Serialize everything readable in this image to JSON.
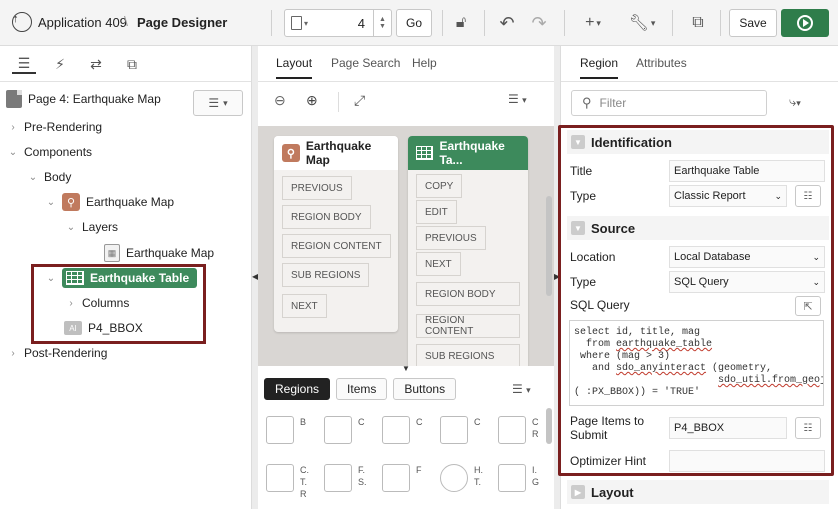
{
  "toolbar": {
    "app_name": "Application 409",
    "page_designer": "Page Designer",
    "page_number": "4",
    "go_label": "Go",
    "save_label": "Save"
  },
  "left_pane": {
    "page_title": "Page 4: Earthquake Map",
    "tree": {
      "pre_rendering": "Pre-Rendering",
      "components": "Components",
      "body": "Body",
      "earthquake_map": "Earthquake Map",
      "layers": "Layers",
      "layer_earthquake_map": "Earthquake Map",
      "earthquake_table": "Earthquake Table",
      "columns": "Columns",
      "item": "P4_BBOX",
      "item_badge": "AI",
      "post_rendering": "Post-Rendering"
    }
  },
  "mid_pane": {
    "tabs": [
      "Layout",
      "Page Search",
      "Help"
    ],
    "map_card": {
      "title": "Earthquake Map",
      "slots": [
        "PREVIOUS",
        "REGION BODY",
        "REGION CONTENT",
        "SUB REGIONS",
        "NEXT"
      ]
    },
    "table_card": {
      "title": "Earthquake Ta...",
      "slots": [
        "COPY",
        "EDIT",
        "PREVIOUS",
        "NEXT",
        "REGION BODY",
        "REGION CONTENT",
        "SUB REGIONS"
      ]
    },
    "gallery_tabs": [
      "Regions",
      "Items",
      "Buttons"
    ],
    "gallery_row1": [
      "B",
      "C",
      "C",
      "C",
      "C\nR"
    ],
    "gallery_row2": [
      "C.\nT.\nR",
      "F.\nS.",
      "F",
      "H.\nT.",
      "I.\nG"
    ]
  },
  "right_pane": {
    "tabs": [
      "Region",
      "Attributes"
    ],
    "filter_placeholder": "Filter",
    "identification": {
      "header": "Identification",
      "title_label": "Title",
      "title_value": "Earthquake Table",
      "type_label": "Type",
      "type_value": "Classic Report"
    },
    "source": {
      "header": "Source",
      "location_label": "Location",
      "location_value": "Local Database",
      "type_label": "Type",
      "type_value": "SQL Query",
      "sql_label": "SQL Query",
      "sql_line1": "select id, title, mag",
      "sql_line2_a": "  from ",
      "sql_line2_b": "earthquake_table",
      "sql_line3": " where (mag > 3)",
      "sql_line4_a": "   and ",
      "sql_line4_b": "sdo_anyinteract",
      "sql_line4_c": " (geometry,",
      "sql_line5_pad": "                        ",
      "sql_line5_b": "sdo_util.from_geojson",
      "sql_line6": "( :PX_BBOX)) = 'TRUE'",
      "page_items_label": "Page Items to Submit",
      "page_items_value": "P4_BBOX",
      "optimizer_label": "Optimizer Hint"
    },
    "layout_header": "Layout"
  },
  "colors": {
    "accent_green": "#3d8a5c",
    "highlight_red": "#7a1f1f",
    "map_icon": "#c07a5e"
  }
}
